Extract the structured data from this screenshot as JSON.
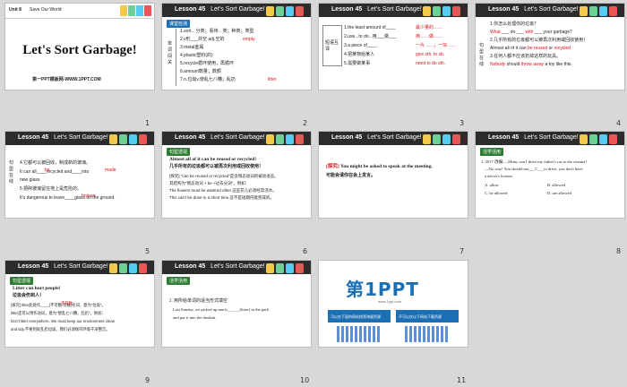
{
  "slides": [
    {
      "num": "1",
      "unit": "Unit 8",
      "topic": "Save Our World",
      "title": "Let's Sort Garbage!",
      "footer": "第一PPT模板网-WWW.1PPT.COM"
    },
    {
      "num": "2",
      "lesson": "Lesson 45",
      "subtitle": "Let’s Sort Garbage!",
      "section": "课堂检测",
      "side": "单词闯关",
      "items": [
        "1.sort←分类；看待←类；种类；类型",
        "2.v形___并空 adj.空的",
        "3.metal金属",
        "4.plastic塑料(的)",
        "5.recycle循环使用，再循环",
        "6.amount数量；数额",
        "7.n.垃圾v.使乱七八糟；乱扔"
      ],
      "fills": [
        "empty",
        "litter"
      ]
    },
    {
      "num": "3",
      "lesson": "Lesson 45",
      "subtitle": "Let’s Sort Garbage!",
      "side": "短语互译",
      "items": [
        "1.the least amount of____",
        "2.use...to do...用___做___",
        "3.a piece of____",
        "4.把某物给某人",
        "5.需要做某事"
      ],
      "answers": [
        "最少量的……",
        "用……做……",
        "一片……；一块……",
        "give sth. to sb.",
        "need to do sth."
      ]
    },
    {
      "num": "4",
      "lesson": "Lesson 45",
      "subtitle": "Let’s Sort Garbage!",
      "side": "句型在线",
      "items": [
        "1.你怎么处理你的垃圾？",
        "2.几乎所有的垃圾都可以被再次利用或回收使用！",
        "3.任何人都不应该扔掉这样的玩具。"
      ],
      "q1": [
        "What",
        "do",
        "with",
        "your garbage?"
      ],
      "q2": [
        "Almost all of it can",
        "be",
        "reused",
        "or",
        "recycled"
      ],
      "q3": [
        "Nobody",
        "should",
        "throw",
        "away",
        "a toy like this."
      ]
    },
    {
      "num": "5",
      "lesson": "Lesson 45",
      "subtitle": "Let’s Sort Garbage!",
      "side": "句型在线",
      "items": [
        "4.它都可以被回收，制成新的玻璃。",
        "It can all____recycled and____into",
        "new glass.",
        "5.把碎玻璃留在地上是危险的。",
        "It's dangerous to leave____glass on the ground."
      ],
      "answers": [
        "be",
        "made",
        "broken"
      ]
    },
    {
      "num": "6",
      "lesson": "Lesson 45",
      "subtitle": "Let’s Sort Garbage!",
      "section": "句型透视",
      "point": "Almost all of it can be reused or recycled!",
      "point_cn": "几乎所有的垃圾都可以被再次利用或回收使用！",
      "notes": [
        "[探究] \"can be reused or recycled\"是含情态动词的被动语态。",
        "其结构为\"情态动词 + be +过去分词\"，例如：",
        "The flowers must be watered often.这些花儿必须经常浇水。",
        "This can't be done in a short time.这不是短期内能完成的。"
      ]
    },
    {
      "num": "7",
      "lesson": "Lesson 45",
      "subtitle": "Let’s Sort Garbage!",
      "tag": "[探究]",
      "sentence": "You might be asked to speak at the meeting.",
      "sentence_cn": "可能会请你在会上发言。"
    },
    {
      "num": "8",
      "lesson": "Lesson 45",
      "subtitle": "Let’s Sort Garbage!",
      "section": "活学活用",
      "question": "1. 2017·改编 —Mum, can I drive my father's car to the cinema?",
      "line2": "—No way! You should not___C___to drive, you don't have",
      "line3": "a driver's license.",
      "options": [
        "A. allow",
        "B. allowed",
        "C. be allowed",
        "D. are allowed"
      ]
    },
    {
      "num": "9",
      "lesson": "Lesson 45",
      "subtitle": "Let’s Sort Garbage!",
      "section": "句型透视",
      "point": "Litter can hurt people!",
      "point_cn": "垃圾会伤到人！",
      "notes": [
        "[探究] litter此处作____(不可数/可数)名词，意为\"垃圾\"。",
        "litter还可以用作动词，意为\"使乱七八糟，乱扔\"。例如：",
        "Don't litter everywhere. We must keep our environment clean",
        "and tidy.不要到处乱扔垃圾。我们必须保持环境干净整洁。"
      ],
      "fill": "不可数"
    },
    {
      "num": "10",
      "lesson": "Lesson 45",
      "subtitle": "Let’s Sort Garbage!",
      "section": "活学活用",
      "question": "2. 用所给单词的适当形式填空",
      "line2": "Last Sunday, we picked up much______(litter) in the park",
      "line3": "and put it into the dustbin."
    },
    {
      "num": "11",
      "brand": "第1PPT",
      "site": "www.1ppt.com",
      "box1": "可以在下面的网站找到海量资源",
      "box2": "不可以在以下网站下载资源"
    }
  ],
  "colors": {
    "header": "#2c2c2c",
    "accent_red": "#d9121c",
    "accent_green": "#2e7d32",
    "brand_blue": "#1a6fb5"
  }
}
